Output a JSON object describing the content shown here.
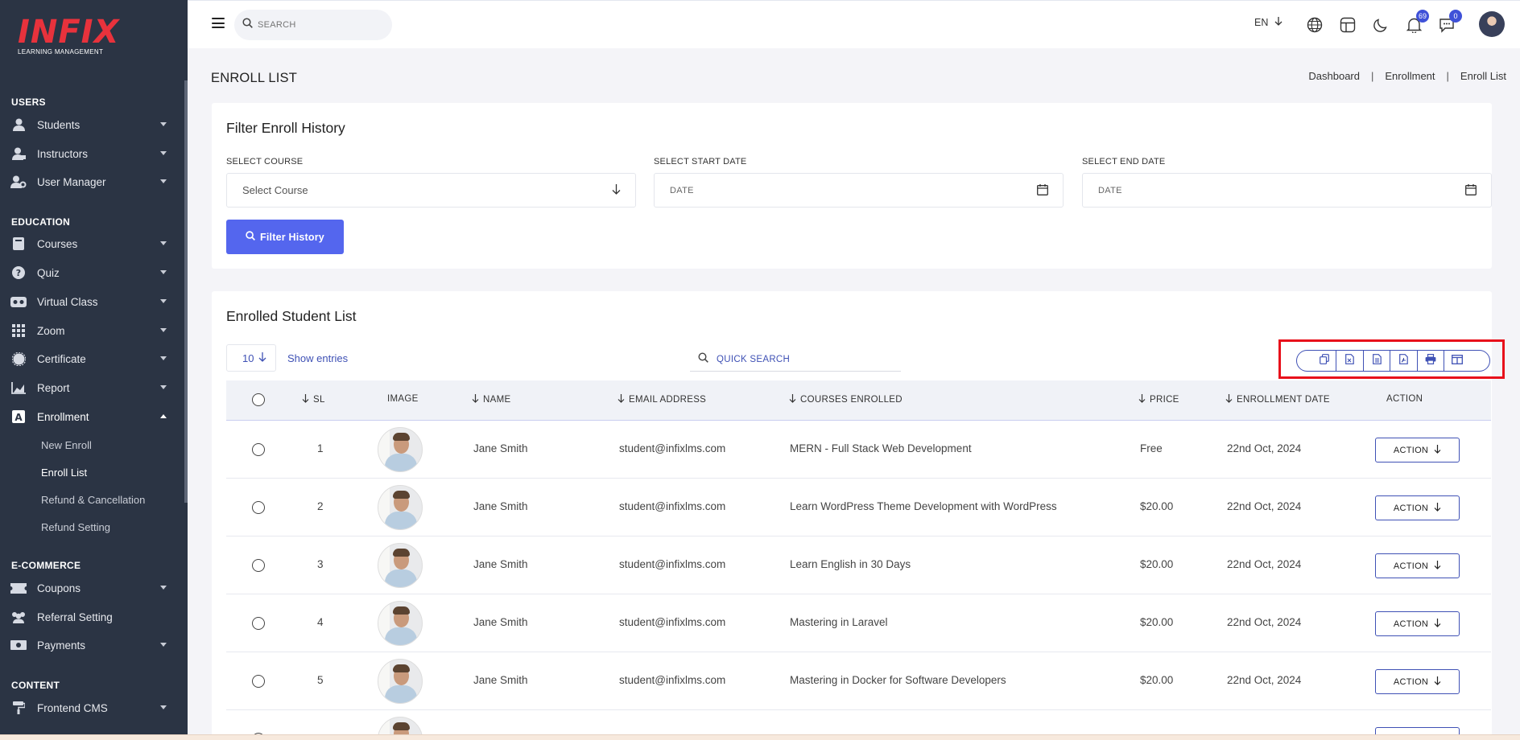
{
  "sidebar": {
    "logo": "INFIX",
    "logo_sub": "LEARNING MANAGEMENT",
    "sections": {
      "users": "USERS",
      "education": "EDUCATION",
      "ecommerce": "E-COMMERCE",
      "content": "CONTENT"
    },
    "items": {
      "students": "Students",
      "instructors": "Instructors",
      "user_manager": "User Manager",
      "courses": "Courses",
      "quiz": "Quiz",
      "virtual_class": "Virtual Class",
      "zoom": "Zoom",
      "certificate": "Certificate",
      "report": "Report",
      "enrollment": "Enrollment",
      "coupons": "Coupons",
      "referral_setting": "Referral Setting",
      "payments": "Payments",
      "frontend_cms": "Frontend CMS"
    },
    "enrollment_sub": {
      "new_enroll": "New Enroll",
      "enroll_list": "Enroll List",
      "refund_cancellation": "Refund & Cancellation",
      "refund_setting": "Refund Setting"
    }
  },
  "topbar": {
    "search_placeholder": "SEARCH",
    "language": "EN",
    "notification_count": "69",
    "message_count": "0"
  },
  "page": {
    "title": "ENROLL LIST",
    "breadcrumb": [
      "Dashboard",
      "Enrollment",
      "Enroll List"
    ]
  },
  "filter": {
    "title": "Filter Enroll History",
    "course_label": "SELECT COURSE",
    "course_value": "Select Course",
    "start_label": "SELECT START DATE",
    "start_placeholder": "DATE",
    "end_label": "SELECT END DATE",
    "end_placeholder": "DATE",
    "button": "Filter History"
  },
  "list": {
    "title": "Enrolled Student List",
    "entries": "10",
    "show_entries": "Show entries",
    "quick_search": "QUICK SEARCH",
    "columns": {
      "sl": "SL",
      "image": "IMAGE",
      "name": "NAME",
      "email": "EMAIL ADDRESS",
      "courses": "COURSES ENROLLED",
      "price": "PRICE",
      "date": "ENROLLMENT DATE",
      "action": "ACTION"
    },
    "action_label": "ACTION",
    "rows": [
      {
        "sl": "1",
        "name": "Jane Smith",
        "email": "student@infixlms.com",
        "course": "MERN - Full Stack Web Development",
        "price": "Free",
        "date": "22nd Oct, 2024"
      },
      {
        "sl": "2",
        "name": "Jane Smith",
        "email": "student@infixlms.com",
        "course": "Learn WordPress Theme Development with WordPress",
        "price": "$20.00",
        "date": "22nd Oct, 2024"
      },
      {
        "sl": "3",
        "name": "Jane Smith",
        "email": "student@infixlms.com",
        "course": "Learn English in 30 Days",
        "price": "$20.00",
        "date": "22nd Oct, 2024"
      },
      {
        "sl": "4",
        "name": "Jane Smith",
        "email": "student@infixlms.com",
        "course": "Mastering in Laravel",
        "price": "$20.00",
        "date": "22nd Oct, 2024"
      },
      {
        "sl": "5",
        "name": "Jane Smith",
        "email": "student@infixlms.com",
        "course": "Mastering in Docker for Software Developers",
        "price": "$20.00",
        "date": "22nd Oct, 2024"
      }
    ]
  },
  "colors": {
    "sidebar_bg": "#2b3444",
    "accent": "#5466ee",
    "brand_red": "#e8323c",
    "highlight": "#e8101b"
  }
}
